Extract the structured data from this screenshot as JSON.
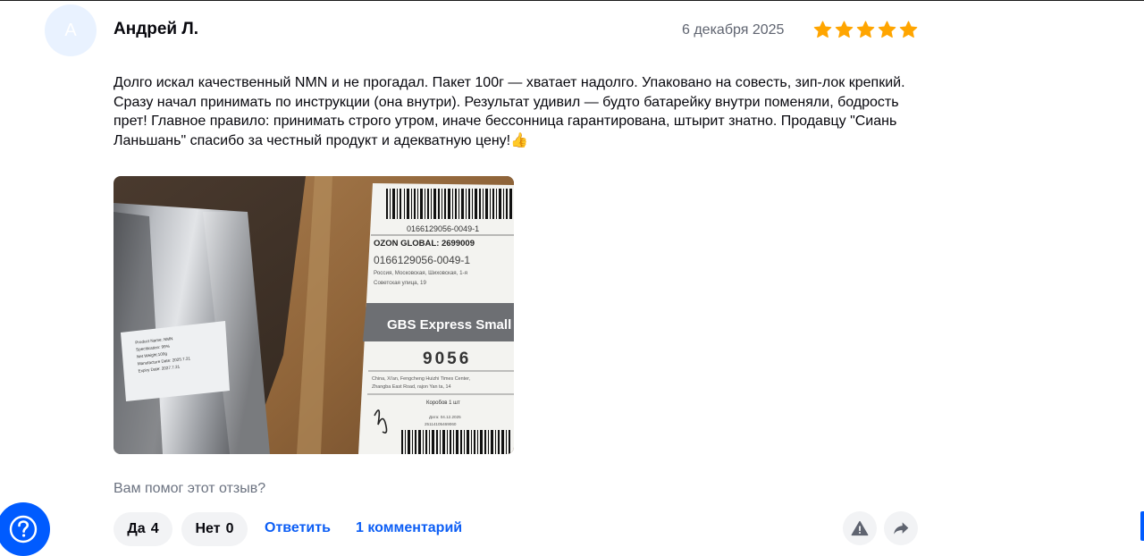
{
  "review": {
    "avatar_letter": "А",
    "author": "Андрей Л.",
    "date": "6 декабря 2025",
    "rating": 5,
    "text": "Долго искал качественный NMN и не прогадал. Пакет 100г — хватает надолго. Упаковано на совесть, зип-лок крепкий. Сразу начал принимать по инструкции (она внутри). Результат удивил — будто батарейку внутри поменяли, бодрость прет! Главное правило: принимать строго утром, иначе бессонница гарантирована, штырит знатно. Продавцу \"Сиань Ланьшань\" спасибо за честный продукт и адекватную цену!👍"
  },
  "photo": {
    "package_label_lines": [
      "Product Name: NMN",
      "Specification: 99%",
      "Net Weight:100g",
      "Manufacture Date: 2025.7.21",
      "Expiry Date: 2027.7.21"
    ],
    "barcode_top": "0166129056-0049-1",
    "ozon_global": "OZON GLOBAL: 2699009",
    "tracking": "0166129056-0049-1",
    "address_line1": "Россия, Московская, Шиховская, 1-я",
    "address_line2": "Советская улица, 19",
    "courier": "GBS Express Small",
    "code": "9056",
    "sender_line1": "China, Xi'an, Fengcheng Huizhi Times Center,",
    "sender_line2": "Zhangba East Road, rajon Yan ta, 14",
    "boxes": "Коробов 1 шт",
    "label_date": "Дата: 04.12.2025",
    "label_ref": "25114105469060"
  },
  "helpful": {
    "question": "Вам помог этот отзыв?",
    "yes_label": "Да",
    "yes_count": "4",
    "no_label": "Нет",
    "no_count": "0"
  },
  "actions": {
    "reply": "Ответить",
    "comments": "1 комментарий"
  },
  "colors": {
    "star": "#ffa500",
    "link": "#0c5ef5",
    "fab": "#005bff",
    "button_bg": "#f2f3f5",
    "avatar_bg": "#e9f2ff"
  },
  "icons": [
    "star-icon",
    "warning-icon",
    "share-arrow-icon",
    "help-question-icon"
  ]
}
